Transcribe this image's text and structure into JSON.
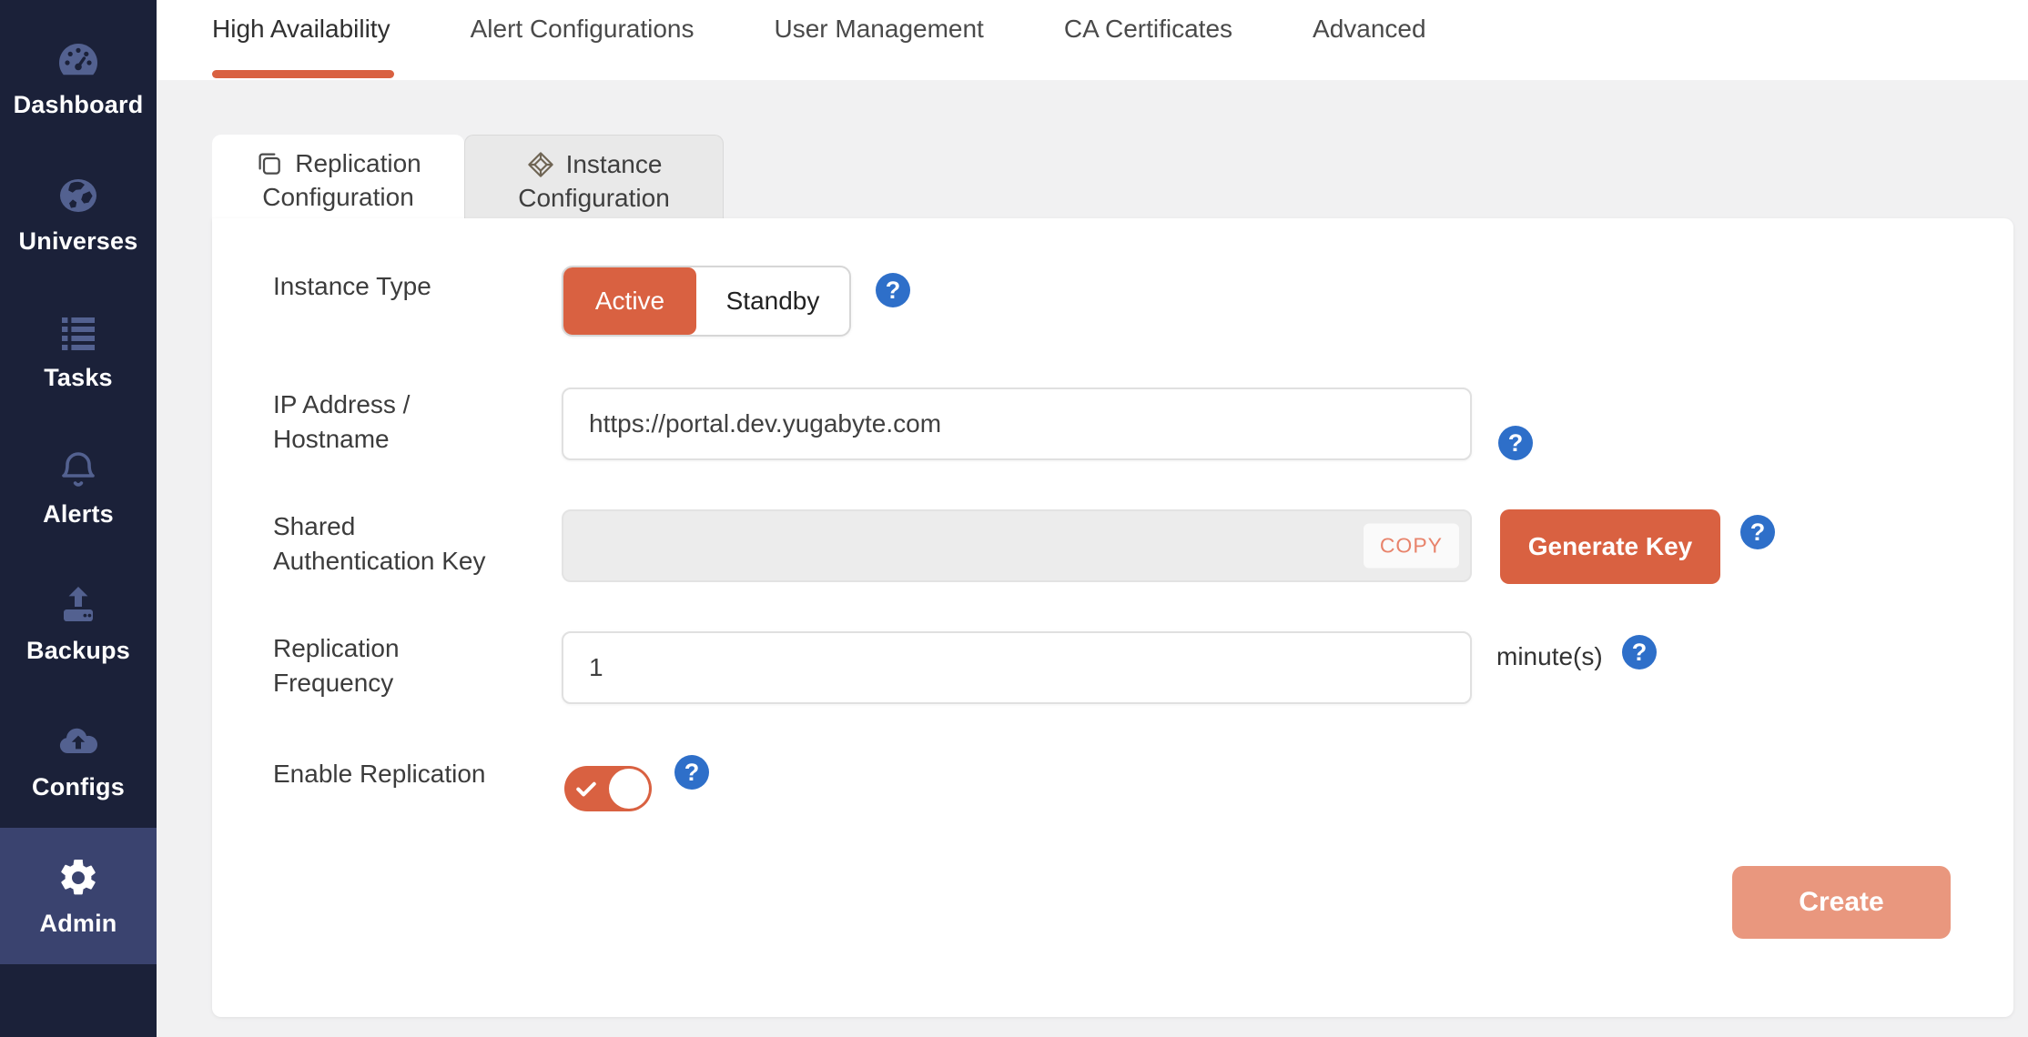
{
  "colors": {
    "accent_orange": "#D96141",
    "create_button_disabled": "#E9977E",
    "help_blue": "#2E6FC9",
    "sidebar_bg": "#1B2139",
    "sidebar_active_bg": "#3A436F",
    "sidebar_icon": "#536190"
  },
  "icons": {
    "help_glyph": "?"
  },
  "sidebar": {
    "items": [
      {
        "label": "Dashboard",
        "icon": "gauge-icon",
        "active": false
      },
      {
        "label": "Universes",
        "icon": "globe-icon",
        "active": false
      },
      {
        "label": "Tasks",
        "icon": "task-list-icon",
        "active": false
      },
      {
        "label": "Alerts",
        "icon": "bell-icon",
        "active": false
      },
      {
        "label": "Backups",
        "icon": "backup-upload-icon",
        "active": false
      },
      {
        "label": "Configs",
        "icon": "cloud-upload-icon",
        "active": false
      },
      {
        "label": "Admin",
        "icon": "gear-icon",
        "active": true
      }
    ]
  },
  "tabs": {
    "items": [
      {
        "label": "High Availability",
        "active": true
      },
      {
        "label": "Alert Configurations",
        "active": false
      },
      {
        "label": "User Management",
        "active": false
      },
      {
        "label": "CA Certificates",
        "active": false
      },
      {
        "label": "Advanced",
        "active": false
      }
    ]
  },
  "subtabs": {
    "items": [
      {
        "label": "Replication Configuration",
        "label_top": "Replication",
        "label_bottom": "Configuration",
        "icon": "copy-icon",
        "active": true
      },
      {
        "label": "Instance Configuration",
        "label_top": "Instance",
        "label_bottom": "Configuration",
        "icon": "cube-icon",
        "active": false
      }
    ]
  },
  "form": {
    "instance_type": {
      "label": "Instance Type",
      "options": [
        "Active",
        "Standby"
      ],
      "selected": "Active"
    },
    "ip_address": {
      "label": "IP Address / Hostname",
      "value": "https://portal.dev.yugabyte.com"
    },
    "shared_key": {
      "label": "Shared Authentication Key",
      "value": "",
      "copy_label": "COPY",
      "generate_label": "Generate Key"
    },
    "replication_frequency": {
      "label": "Replication Frequency",
      "value": "1",
      "unit": "minute(s)"
    },
    "enable_replication": {
      "label": "Enable Replication",
      "enabled": true
    },
    "create_label": "Create"
  }
}
